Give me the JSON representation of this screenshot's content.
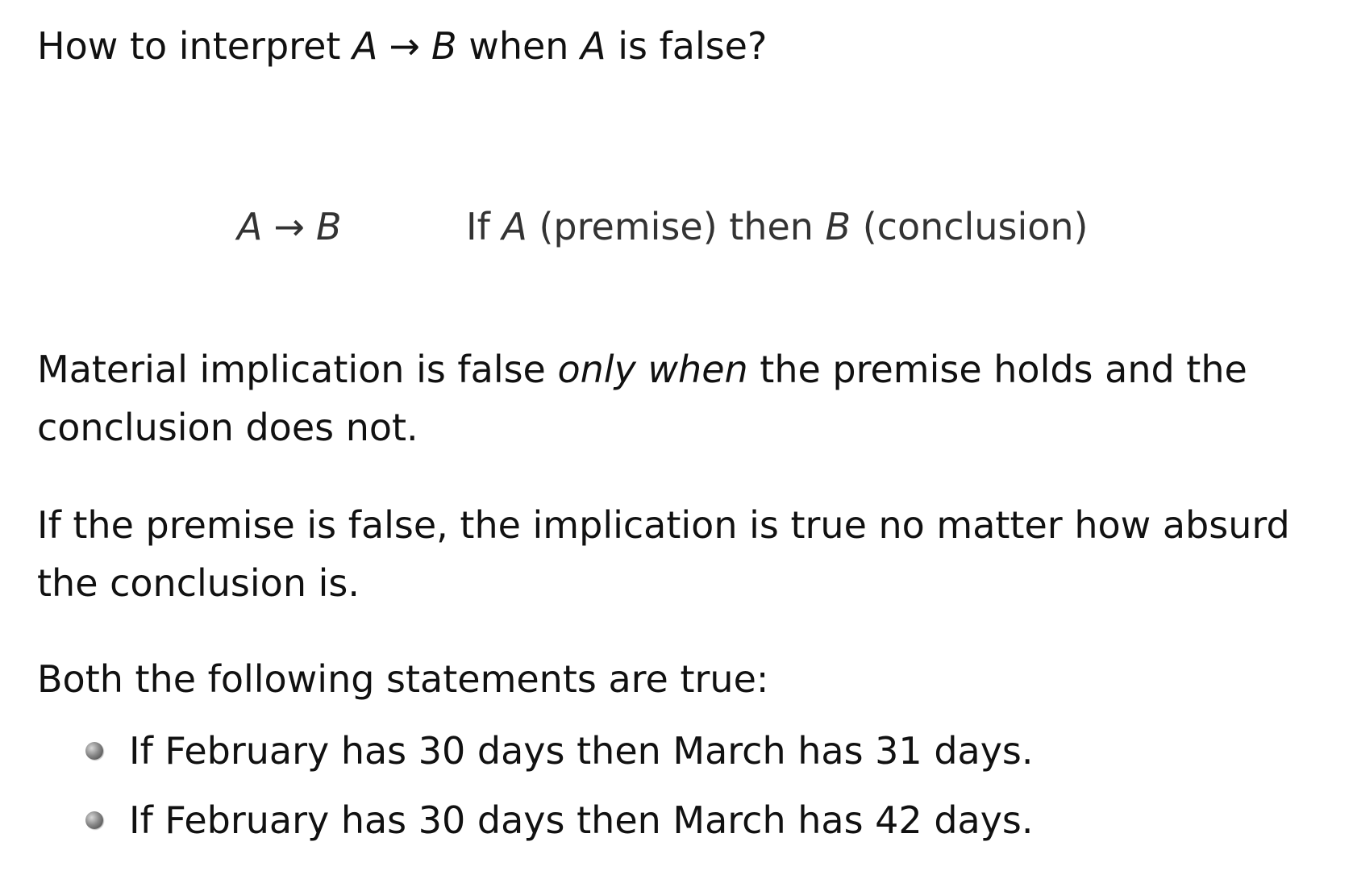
{
  "heading": {
    "prefix": "How to interpret",
    "var_a": "A",
    "arrow": "→",
    "var_b": "B",
    "middle": "when",
    "var_a2": "A",
    "suffix": "is false?"
  },
  "formula": {
    "var_a": "A",
    "arrow": "→",
    "var_b": "B",
    "desc_if": "If",
    "desc_var_a": "A",
    "desc_premise": "(premise) then",
    "desc_var_b": "B",
    "desc_conclusion": "(conclusion)"
  },
  "paragraph1": {
    "before": "Material implication is false",
    "emphasis": "only when",
    "after": "the premise holds and the conclusion does not."
  },
  "paragraph2": {
    "text": "If the premise is false, the implication is true no matter how absurd the conclusion is."
  },
  "paragraph3": {
    "text": "Both the following statements are true:"
  },
  "bullets": [
    {
      "text": "If February has 30 days then March has 31 days."
    },
    {
      "text": "If February has 30 days then March has 42 days."
    }
  ]
}
